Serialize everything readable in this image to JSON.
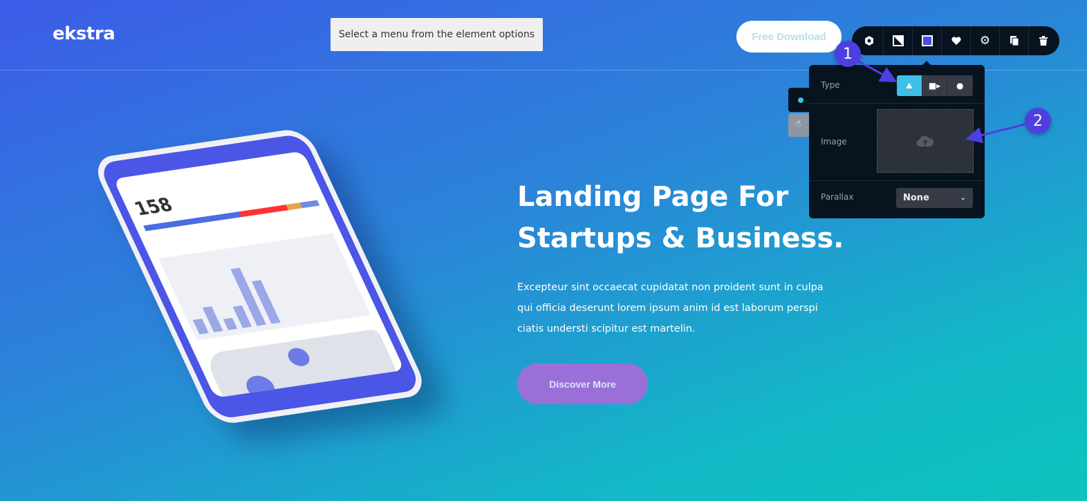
{
  "header": {
    "logo": "ekstra",
    "menu_note": "Select a menu from the element options",
    "download_label": "Free Download"
  },
  "toolbar": {
    "icons": [
      "hexagon-icon",
      "background-icon",
      "color-square-icon",
      "heart-icon",
      "gear-icon",
      "duplicate-icon",
      "trash-icon"
    ],
    "accent": "#4350e6"
  },
  "panel": {
    "type_label": "Type",
    "type_options": [
      "image",
      "video",
      "color"
    ],
    "image_label": "Image",
    "parallax_label": "Parallax",
    "parallax_value": "None",
    "accent": "#3dbfe8"
  },
  "annotations": [
    "1",
    "2"
  ],
  "hero": {
    "title_line1": "Landing Page For",
    "title_line2": "Startups & Business.",
    "body": "Excepteur sint occaecat cupidatat non proident sunt in culpa qui officia deserunt lorem ipsum anim id est laborum perspi ciatis understi scipitur est martelin.",
    "cta": "Discover More"
  },
  "phone": {
    "stat": "158"
  }
}
